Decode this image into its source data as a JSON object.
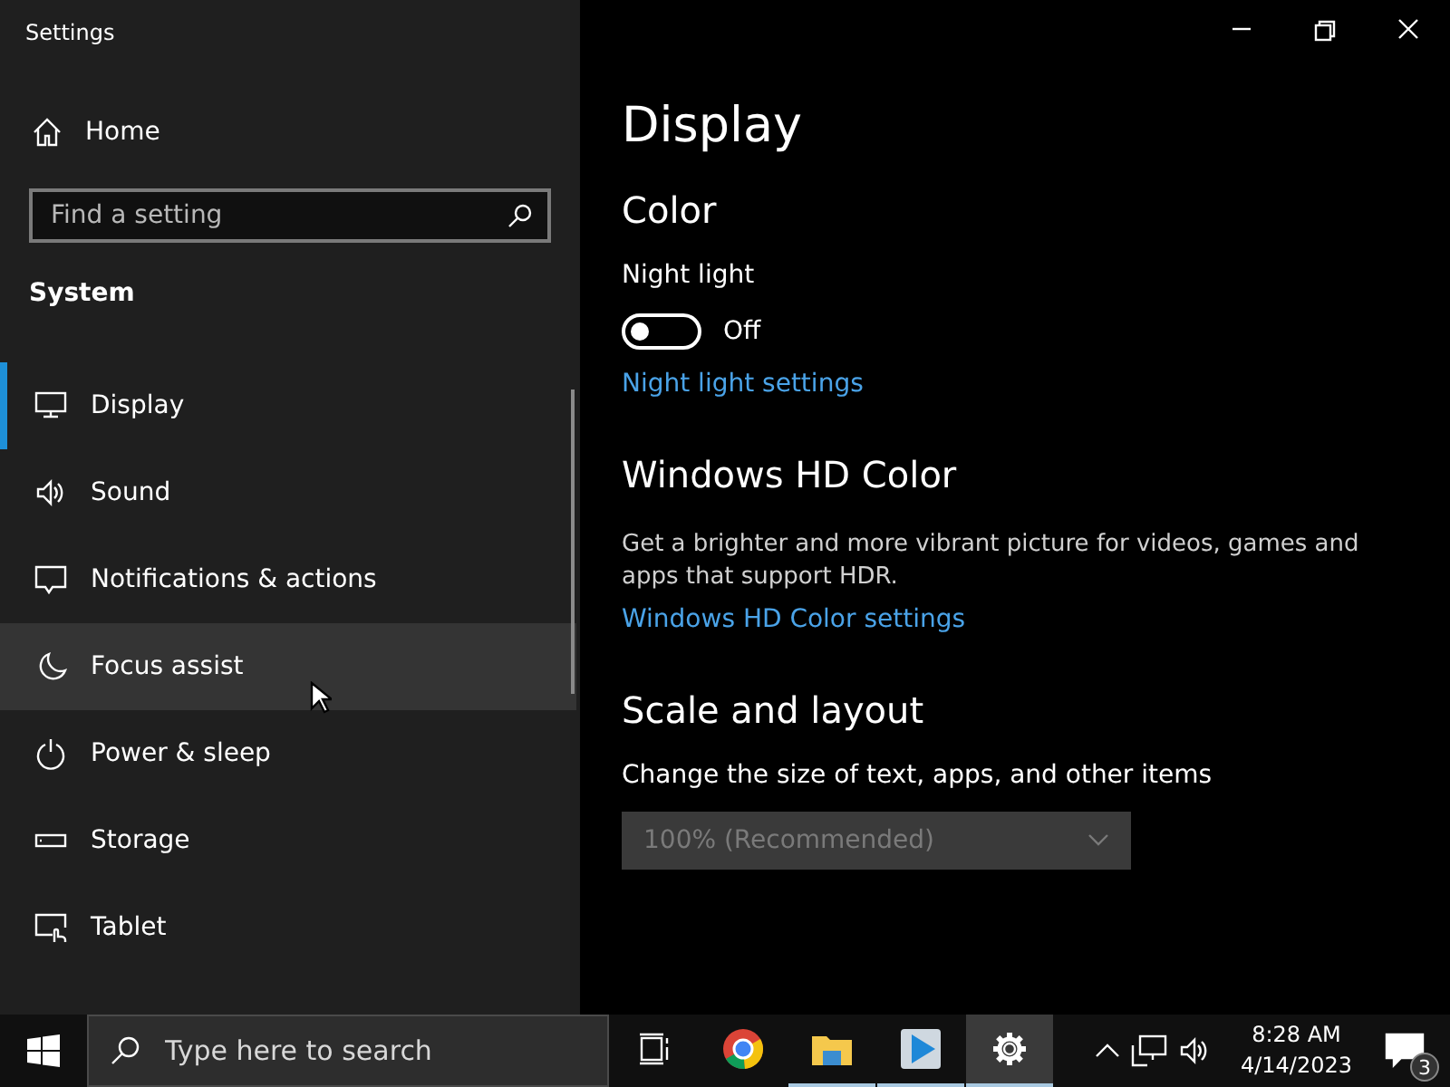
{
  "window": {
    "title": "Settings"
  },
  "sidebar": {
    "home": "Home",
    "search": {
      "placeholder": "Find a setting"
    },
    "section": "System",
    "items": [
      {
        "kind": "display",
        "label": "Display",
        "selected": true,
        "hovered": false
      },
      {
        "kind": "sound",
        "label": "Sound",
        "selected": false,
        "hovered": false
      },
      {
        "kind": "notifications",
        "label": "Notifications & actions",
        "selected": false,
        "hovered": false
      },
      {
        "kind": "focus",
        "label": "Focus assist",
        "selected": false,
        "hovered": true
      },
      {
        "kind": "power",
        "label": "Power & sleep",
        "selected": false,
        "hovered": false
      },
      {
        "kind": "storage",
        "label": "Storage",
        "selected": false,
        "hovered": false
      },
      {
        "kind": "tablet",
        "label": "Tablet",
        "selected": false,
        "hovered": false
      }
    ]
  },
  "main": {
    "title": "Display",
    "color": {
      "heading": "Color",
      "night_light": {
        "label": "Night light",
        "on": false,
        "state": "Off"
      },
      "link": "Night light settings"
    },
    "hd_color": {
      "heading": "Windows HD Color",
      "description": "Get a brighter and more vibrant picture for videos, games and apps that support HDR.",
      "link": "Windows HD Color settings"
    },
    "scale": {
      "heading": "Scale and layout",
      "label": "Change the size of text, apps, and other items",
      "dropdown": {
        "value": "100% (Recommended)",
        "disabled": true
      }
    }
  },
  "taskbar": {
    "search": {
      "placeholder": "Type here to search"
    },
    "apps": [
      {
        "kind": "taskview",
        "running": false,
        "active": false
      },
      {
        "kind": "chrome",
        "running": false,
        "active": false
      },
      {
        "kind": "explorer",
        "running": true,
        "active": false
      },
      {
        "kind": "media",
        "running": true,
        "active": false
      },
      {
        "kind": "settings",
        "running": true,
        "active": true
      }
    ],
    "time": "8:28 AM",
    "date": "4/14/2023",
    "notifications": "3"
  }
}
